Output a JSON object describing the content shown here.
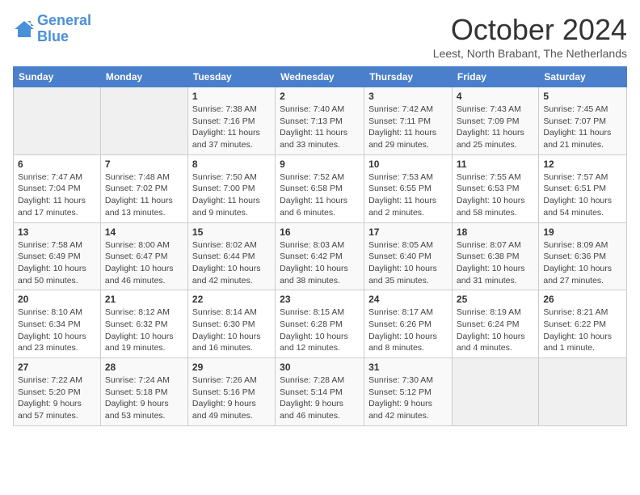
{
  "logo": {
    "line1": "General",
    "line2": "Blue"
  },
  "title": "October 2024",
  "location": "Leest, North Brabant, The Netherlands",
  "days_of_week": [
    "Sunday",
    "Monday",
    "Tuesday",
    "Wednesday",
    "Thursday",
    "Friday",
    "Saturday"
  ],
  "weeks": [
    [
      {
        "day": "",
        "info": ""
      },
      {
        "day": "",
        "info": ""
      },
      {
        "day": "1",
        "info": "Sunrise: 7:38 AM\nSunset: 7:16 PM\nDaylight: 11 hours and 37 minutes."
      },
      {
        "day": "2",
        "info": "Sunrise: 7:40 AM\nSunset: 7:13 PM\nDaylight: 11 hours and 33 minutes."
      },
      {
        "day": "3",
        "info": "Sunrise: 7:42 AM\nSunset: 7:11 PM\nDaylight: 11 hours and 29 minutes."
      },
      {
        "day": "4",
        "info": "Sunrise: 7:43 AM\nSunset: 7:09 PM\nDaylight: 11 hours and 25 minutes."
      },
      {
        "day": "5",
        "info": "Sunrise: 7:45 AM\nSunset: 7:07 PM\nDaylight: 11 hours and 21 minutes."
      }
    ],
    [
      {
        "day": "6",
        "info": "Sunrise: 7:47 AM\nSunset: 7:04 PM\nDaylight: 11 hours and 17 minutes."
      },
      {
        "day": "7",
        "info": "Sunrise: 7:48 AM\nSunset: 7:02 PM\nDaylight: 11 hours and 13 minutes."
      },
      {
        "day": "8",
        "info": "Sunrise: 7:50 AM\nSunset: 7:00 PM\nDaylight: 11 hours and 9 minutes."
      },
      {
        "day": "9",
        "info": "Sunrise: 7:52 AM\nSunset: 6:58 PM\nDaylight: 11 hours and 6 minutes."
      },
      {
        "day": "10",
        "info": "Sunrise: 7:53 AM\nSunset: 6:55 PM\nDaylight: 11 hours and 2 minutes."
      },
      {
        "day": "11",
        "info": "Sunrise: 7:55 AM\nSunset: 6:53 PM\nDaylight: 10 hours and 58 minutes."
      },
      {
        "day": "12",
        "info": "Sunrise: 7:57 AM\nSunset: 6:51 PM\nDaylight: 10 hours and 54 minutes."
      }
    ],
    [
      {
        "day": "13",
        "info": "Sunrise: 7:58 AM\nSunset: 6:49 PM\nDaylight: 10 hours and 50 minutes."
      },
      {
        "day": "14",
        "info": "Sunrise: 8:00 AM\nSunset: 6:47 PM\nDaylight: 10 hours and 46 minutes."
      },
      {
        "day": "15",
        "info": "Sunrise: 8:02 AM\nSunset: 6:44 PM\nDaylight: 10 hours and 42 minutes."
      },
      {
        "day": "16",
        "info": "Sunrise: 8:03 AM\nSunset: 6:42 PM\nDaylight: 10 hours and 38 minutes."
      },
      {
        "day": "17",
        "info": "Sunrise: 8:05 AM\nSunset: 6:40 PM\nDaylight: 10 hours and 35 minutes."
      },
      {
        "day": "18",
        "info": "Sunrise: 8:07 AM\nSunset: 6:38 PM\nDaylight: 10 hours and 31 minutes."
      },
      {
        "day": "19",
        "info": "Sunrise: 8:09 AM\nSunset: 6:36 PM\nDaylight: 10 hours and 27 minutes."
      }
    ],
    [
      {
        "day": "20",
        "info": "Sunrise: 8:10 AM\nSunset: 6:34 PM\nDaylight: 10 hours and 23 minutes."
      },
      {
        "day": "21",
        "info": "Sunrise: 8:12 AM\nSunset: 6:32 PM\nDaylight: 10 hours and 19 minutes."
      },
      {
        "day": "22",
        "info": "Sunrise: 8:14 AM\nSunset: 6:30 PM\nDaylight: 10 hours and 16 minutes."
      },
      {
        "day": "23",
        "info": "Sunrise: 8:15 AM\nSunset: 6:28 PM\nDaylight: 10 hours and 12 minutes."
      },
      {
        "day": "24",
        "info": "Sunrise: 8:17 AM\nSunset: 6:26 PM\nDaylight: 10 hours and 8 minutes."
      },
      {
        "day": "25",
        "info": "Sunrise: 8:19 AM\nSunset: 6:24 PM\nDaylight: 10 hours and 4 minutes."
      },
      {
        "day": "26",
        "info": "Sunrise: 8:21 AM\nSunset: 6:22 PM\nDaylight: 10 hours and 1 minute."
      }
    ],
    [
      {
        "day": "27",
        "info": "Sunrise: 7:22 AM\nSunset: 5:20 PM\nDaylight: 9 hours and 57 minutes."
      },
      {
        "day": "28",
        "info": "Sunrise: 7:24 AM\nSunset: 5:18 PM\nDaylight: 9 hours and 53 minutes."
      },
      {
        "day": "29",
        "info": "Sunrise: 7:26 AM\nSunset: 5:16 PM\nDaylight: 9 hours and 49 minutes."
      },
      {
        "day": "30",
        "info": "Sunrise: 7:28 AM\nSunset: 5:14 PM\nDaylight: 9 hours and 46 minutes."
      },
      {
        "day": "31",
        "info": "Sunrise: 7:30 AM\nSunset: 5:12 PM\nDaylight: 9 hours and 42 minutes."
      },
      {
        "day": "",
        "info": ""
      },
      {
        "day": "",
        "info": ""
      }
    ]
  ]
}
